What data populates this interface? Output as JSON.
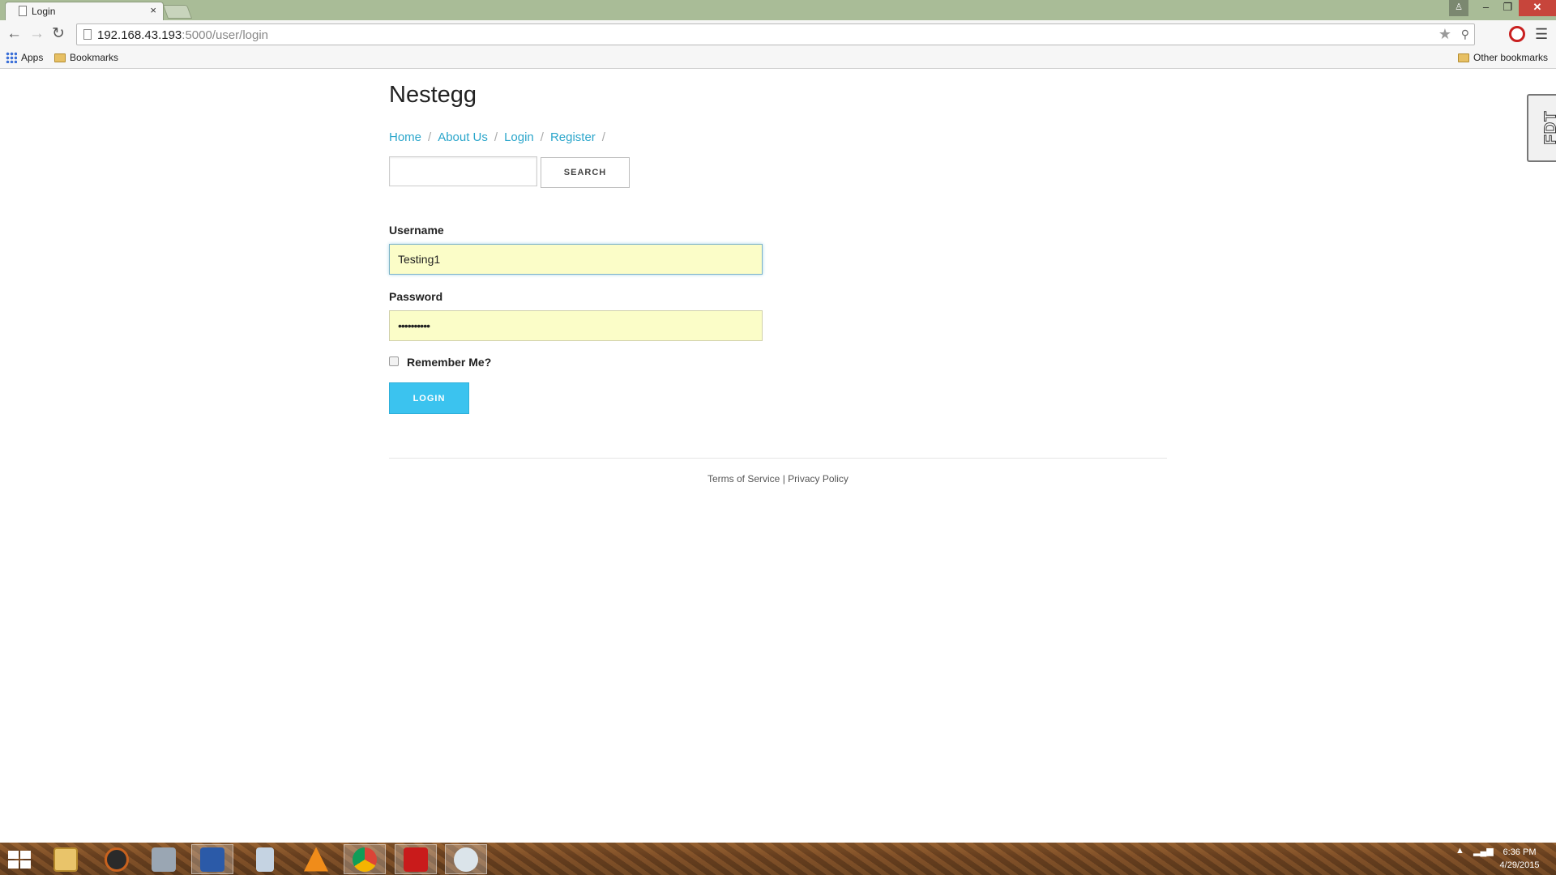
{
  "browser": {
    "tab_title": "Login",
    "tab_close": "×",
    "url_host": "192.168.43.193",
    "url_path": ":5000/user/login",
    "bookmarks": {
      "apps": "Apps",
      "bookmarks": "Bookmarks",
      "other": "Other bookmarks"
    },
    "window_controls": {
      "minimize": "–",
      "maximize": "❐",
      "close": "✕"
    }
  },
  "page": {
    "site_title": "Nestegg",
    "breadcrumb": [
      "Home",
      "About Us",
      "Login",
      "Register"
    ],
    "breadcrumb_separator": "/",
    "search": {
      "placeholder": "",
      "button_label": "SEARCH"
    },
    "form": {
      "username_label": "Username",
      "username_value": "Testing1",
      "password_label": "Password",
      "password_value": "••••••••••",
      "remember_label": "Remember Me?",
      "remember_checked": false,
      "login_label": "LOGIN"
    },
    "footer": {
      "terms": "Terms of Service",
      "separator": "|",
      "privacy": "Privacy Policy"
    },
    "side_tab_label": "FDT"
  },
  "taskbar": {
    "apps": [
      "start-button",
      "file-explorer-icon",
      "media-icon",
      "network-icon",
      "word-icon",
      "calculator-icon",
      "vlc-icon",
      "chrome-icon",
      "acrobat-icon",
      "paint-icon"
    ],
    "active_app": "chrome-icon",
    "clock_time": "6:36 PM",
    "clock_date": "4/29/2015"
  },
  "colors": {
    "link": "#2ba6cb",
    "primary_button": "#3bc3ef",
    "autofill_bg": "#fbfdc8",
    "titlebar": "#a9bc97",
    "close_button": "#c7453b"
  }
}
